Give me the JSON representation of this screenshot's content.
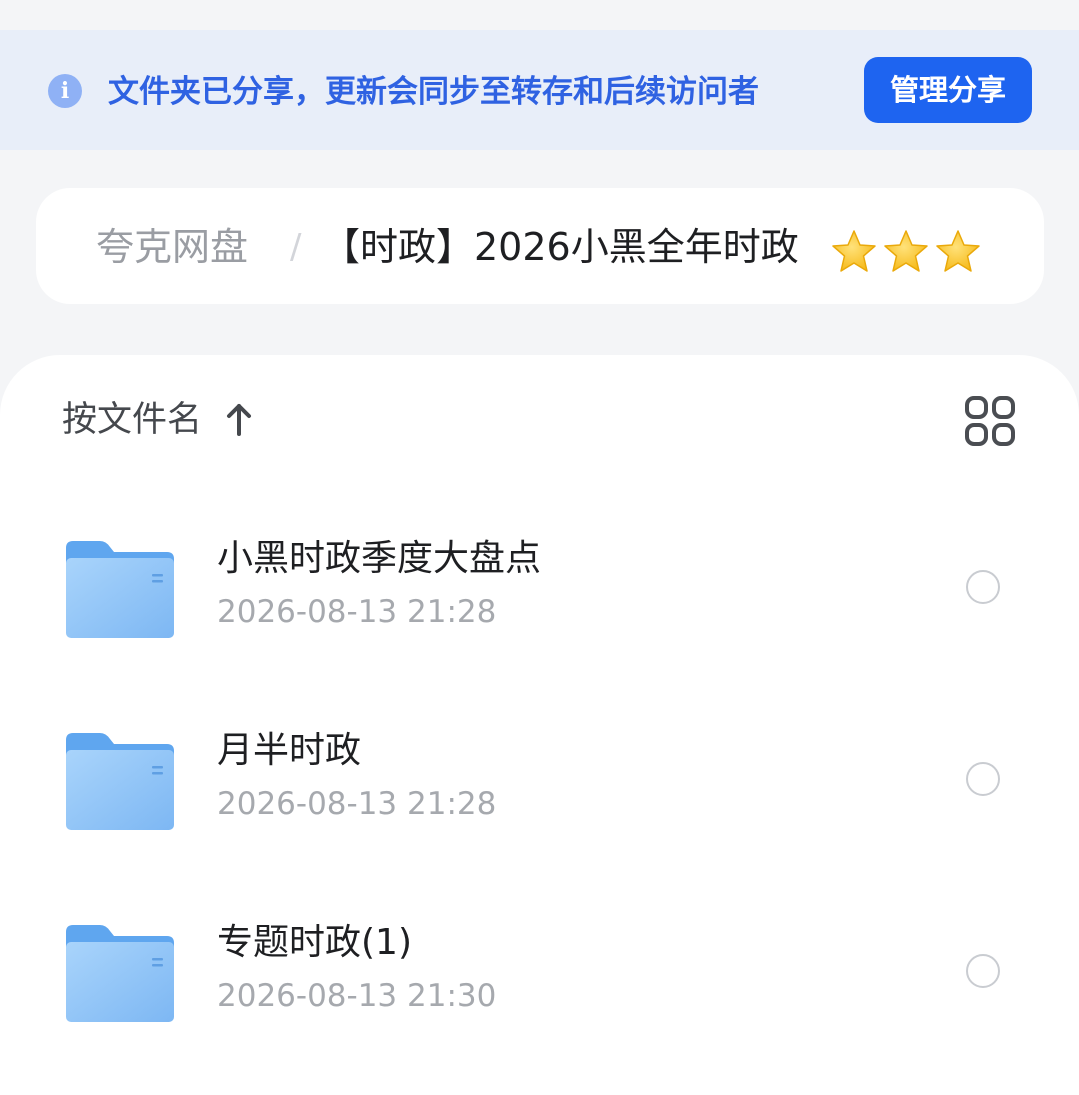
{
  "banner": {
    "message": "文件夹已分享，更新会同步至转存和后续访问者",
    "manage_button": "管理分享",
    "info_icon": "info-icon"
  },
  "breadcrumb": {
    "root": "夸克网盘",
    "separator": "/",
    "current": "【时政】2026小黑全年时政",
    "star_icons": [
      "star-icon",
      "star-icon",
      "star-icon"
    ]
  },
  "toolbar": {
    "sort_label": "按文件名",
    "sort_icon": "arrow-up-icon",
    "view_toggle_icon": "grid-view-icon"
  },
  "files": [
    {
      "name": "小黑时政季度大盘点",
      "date": "2026-08-13 21:28",
      "icon": "folder-icon"
    },
    {
      "name": "月半时政",
      "date": "2026-08-13 21:28",
      "icon": "folder-icon"
    },
    {
      "name": "专题时政(1)",
      "date": "2026-08-13 21:30",
      "icon": "folder-icon"
    }
  ],
  "colors": {
    "accent": "#1e64f0",
    "banner_text": "#2f62e2",
    "banner_bg": "#e8eef9",
    "folder": "#8fc3f7",
    "star": "#f8c21a"
  }
}
